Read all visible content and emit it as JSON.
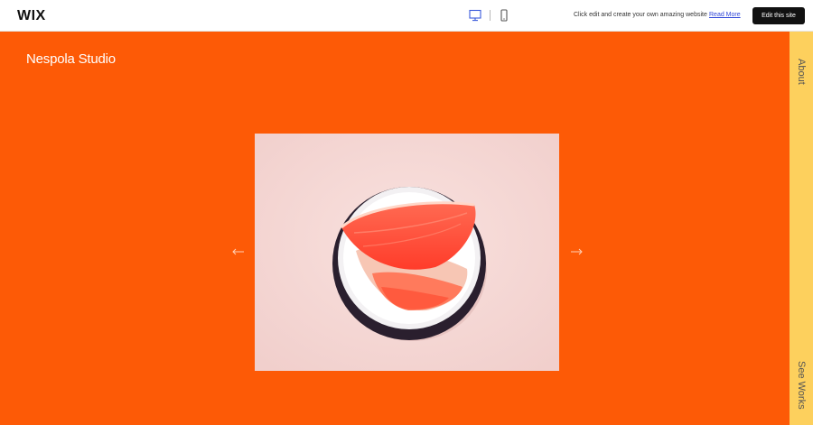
{
  "topbar": {
    "logo": "WIX",
    "devices": [
      "desktop-icon",
      "mobile-icon"
    ],
    "tagline": "Click edit and create your own amazing website",
    "read_more": "Read More",
    "edit_button": "Edit this site"
  },
  "site": {
    "title": "Nespola Studio",
    "background_color": "#fd5a06",
    "side_panel_color": "#fdd05d"
  },
  "gallery": {
    "prev_icon": "arrow-left-icon",
    "next_icon": "arrow-right-icon",
    "image": "grapefruit-slice-on-plate"
  },
  "side_nav": {
    "items": [
      {
        "label": "About"
      },
      {
        "label": "See Works"
      }
    ]
  }
}
